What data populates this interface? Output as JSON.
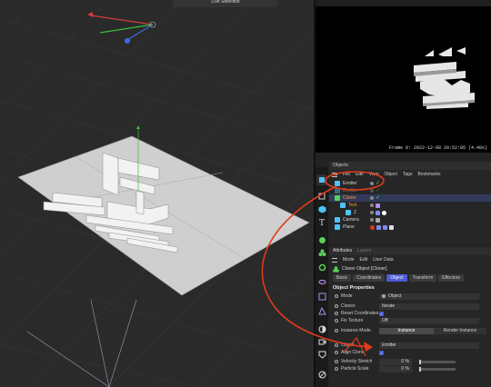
{
  "viewport": {
    "mode_label": "Live Selection"
  },
  "preview": {
    "frame_label": "Frame 0:",
    "frame_datetime": "2022-12-08 20:52:05",
    "frame_time": "(4.40s)"
  },
  "objects_panel": {
    "title": "Objects",
    "menu": [
      "File",
      "Edit",
      "View",
      "Object",
      "Tags",
      "Bookmarks"
    ],
    "rows": [
      {
        "name": "Emitter",
        "icon_color": "#4fc3f7"
      },
      {
        "name": "Emitter",
        "icon_color": "#4fc3f7"
      },
      {
        "name": "Cloner",
        "icon_color": "#5bd15b"
      },
      {
        "name": "Text",
        "icon_color": "#4fc3f7"
      },
      {
        "name": "Z",
        "icon_color": "#4fc3f7"
      },
      {
        "name": "Camera",
        "icon_color": "#4fc3f7"
      },
      {
        "name": "Plane",
        "icon_color": "#4fc3f7"
      }
    ]
  },
  "attributes_panel": {
    "tabs": [
      "Attributes",
      "Layers"
    ],
    "menu": [
      "Mode",
      "Edit",
      "User Data"
    ],
    "object_title": "Cloner Object [Cloner]",
    "subtabs": [
      "Basic",
      "Coordinates",
      "Object",
      "Transform",
      "Effectors"
    ],
    "active_subtab": "Object",
    "section_title": "Object Properties",
    "props": {
      "mode": {
        "label": "Mode",
        "value": "Object"
      },
      "clones": {
        "label": "Clones",
        "value": "Iterate"
      },
      "reset_coords": {
        "label": "Reset Coordinates"
      },
      "fix_texture": {
        "label": "Fix Texture",
        "value": "Off"
      },
      "instance_mode": {
        "label": "Instance Mode",
        "value": "Instance",
        "option2": "Render Instance"
      },
      "object": {
        "label": "Object",
        "value": "Emitter"
      },
      "align_clone": {
        "label": "Align Clone"
      },
      "velocity_stretch": {
        "label": "Velocity Stretch",
        "value": "0 %"
      },
      "particle_scale": {
        "label": "Particle Scale",
        "value": "0 %"
      }
    }
  },
  "colors": {
    "accent": "#4b5bd6",
    "annotation_red": "#e23a1a",
    "check_green": "#5bd15b"
  }
}
